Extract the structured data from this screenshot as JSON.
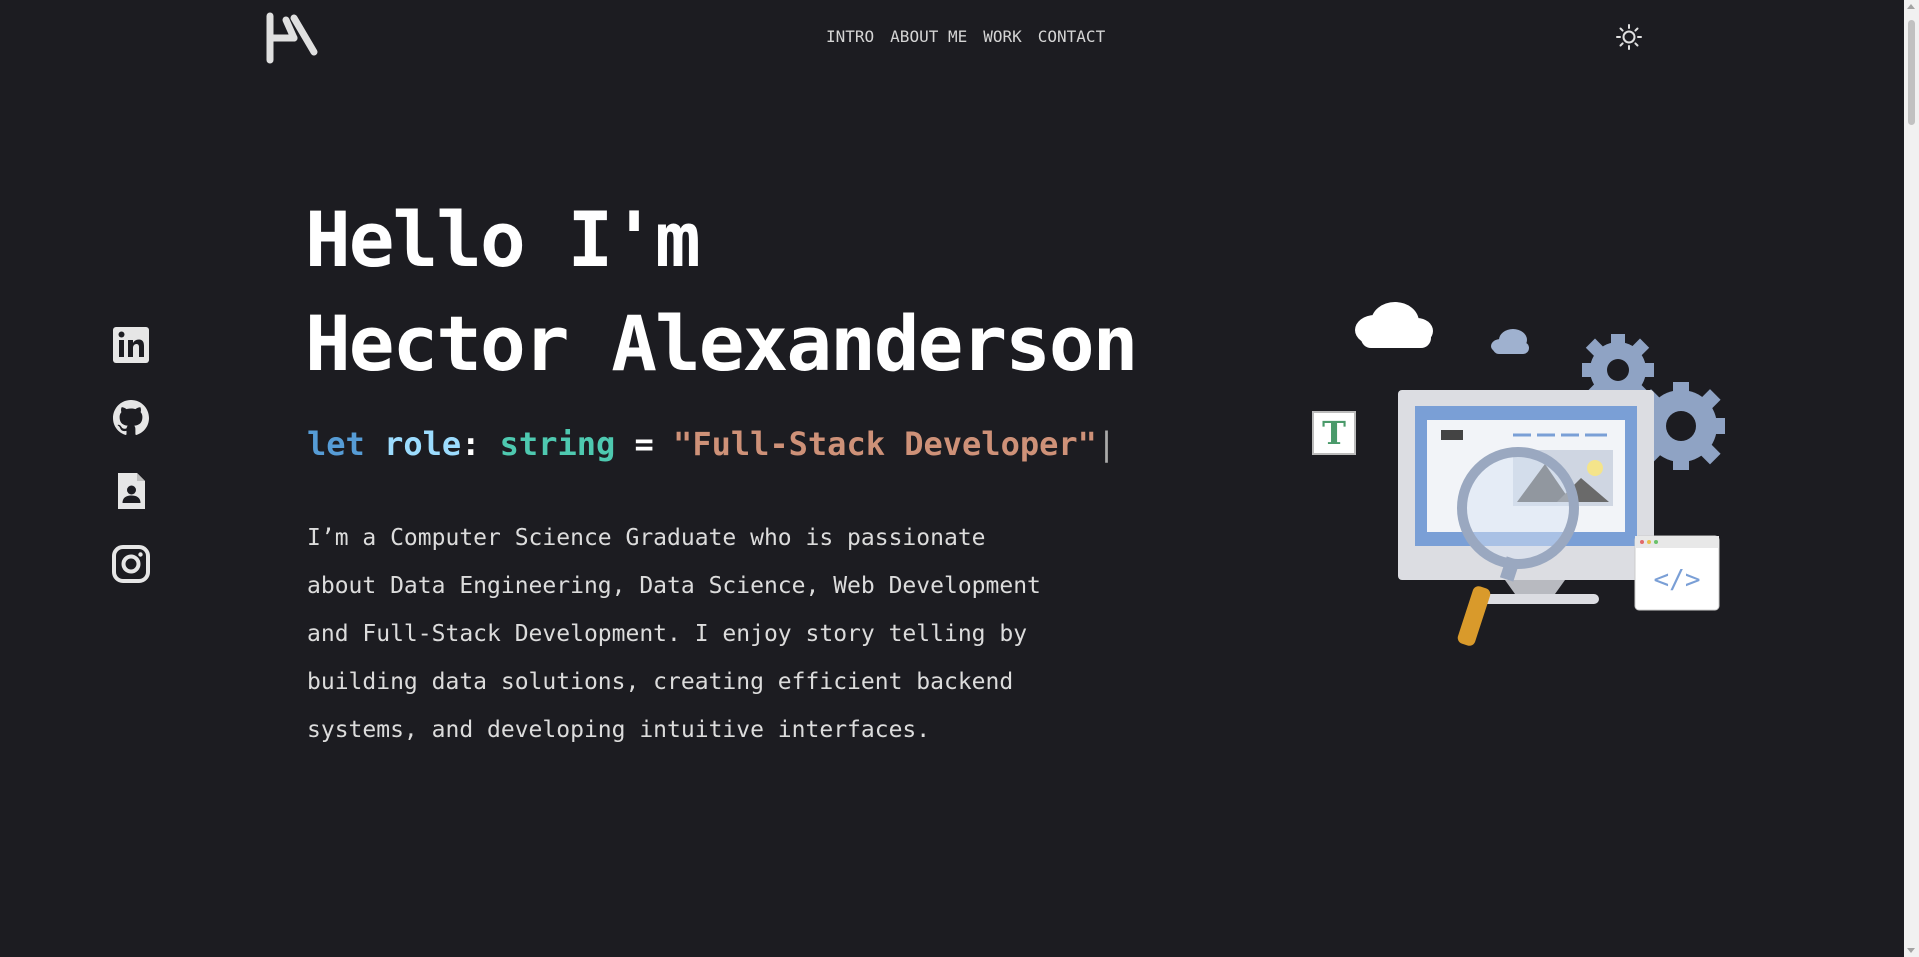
{
  "nav": {
    "items": [
      {
        "label": "INTRO"
      },
      {
        "label": "ABOUT ME"
      },
      {
        "label": "WORK"
      },
      {
        "label": "CONTACT"
      }
    ],
    "theme_icon": "sun-icon",
    "logo_icon": "ha-monogram-logo"
  },
  "socials": [
    {
      "icon": "linkedin-icon"
    },
    {
      "icon": "github-icon"
    },
    {
      "icon": "resume-icon"
    },
    {
      "icon": "instagram-icon"
    }
  ],
  "hero": {
    "title_line1": "Hello I'm",
    "title_line2": "Hector Alexanderson",
    "role_keyword": "let",
    "role_var": "role",
    "role_colon": ":",
    "role_type": "string",
    "role_equals": "=",
    "role_value": "\"Full-Stack Developer\"",
    "cursor": "|",
    "bio": "I’m a Computer Science Graduate who is passionate about Data Engineering, Data Science, Web Development and Full-Stack Development. I enjoy story telling by building data solutions, creating efficient backend systems, and developing intuitive interfaces."
  },
  "illustration": {
    "icon": "developer-illustration",
    "badge_letter": "T",
    "code_symbol": "</>"
  },
  "colors": {
    "background": "#1c1c21",
    "keyword": "#569cd6",
    "variable": "#9cdcfe",
    "type": "#4ec9b0",
    "string": "#ce9178"
  }
}
